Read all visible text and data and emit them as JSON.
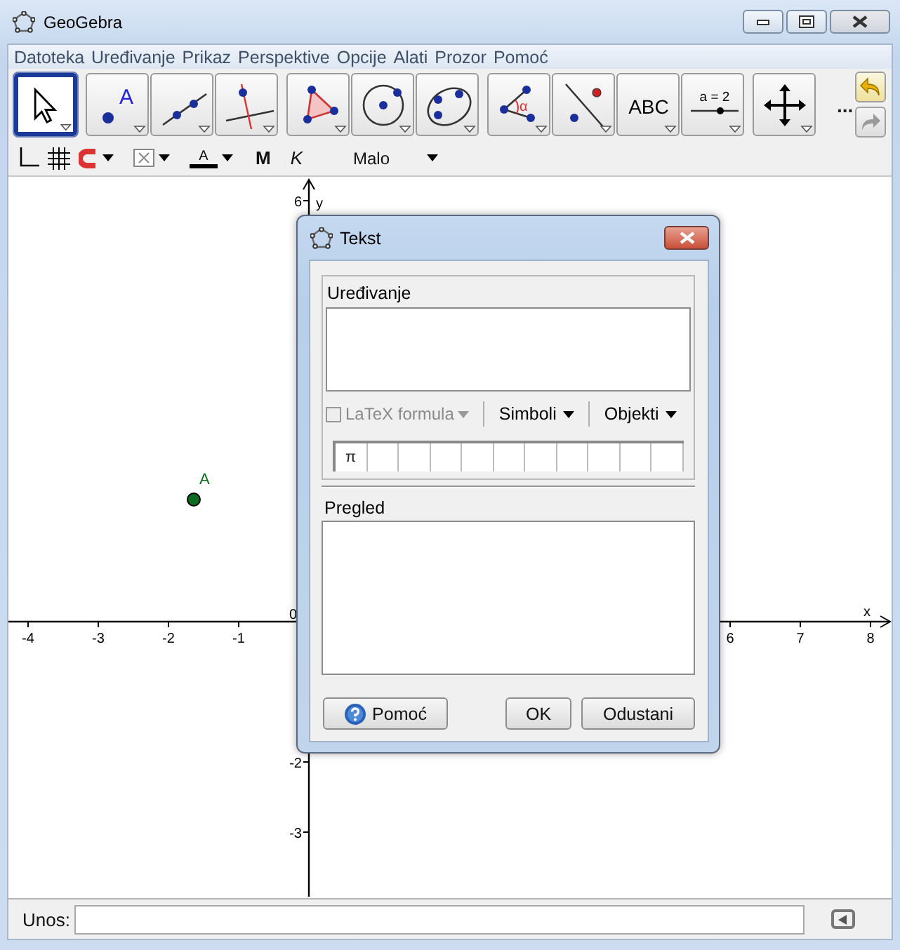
{
  "window": {
    "title": "GeoGebra"
  },
  "menu": [
    "Datoteka",
    "Uređivanje",
    "Prikaz",
    "Perspektive",
    "Opcije",
    "Alati",
    "Prozor",
    "Pomoć"
  ],
  "toolbar": {
    "tools": [
      {
        "kind": "move",
        "selected": true
      },
      {
        "kind": "point",
        "selected": false,
        "text": "A"
      },
      {
        "kind": "line",
        "selected": false
      },
      {
        "kind": "perpendicular",
        "selected": false
      },
      {
        "kind": "polygon",
        "selected": false
      },
      {
        "kind": "circle",
        "selected": false
      },
      {
        "kind": "conic",
        "selected": false
      },
      {
        "kind": "angle",
        "selected": false,
        "text": "α"
      },
      {
        "kind": "reflect",
        "selected": false
      },
      {
        "kind": "text",
        "selected": false,
        "text": "ABC"
      },
      {
        "kind": "slider",
        "selected": false,
        "text": "a = 2"
      },
      {
        "kind": "move_view",
        "selected": false
      }
    ],
    "more": "...",
    "undo": {
      "disabled": false
    },
    "redo": {
      "disabled": true
    }
  },
  "style_bar": {
    "color_letter": "A",
    "bold": "M",
    "italic": "K",
    "size": "Malo"
  },
  "graphics": {
    "x_axis_label": "x",
    "y_axis_label": "y",
    "x_ticks": [
      "-4",
      "-3",
      "-2",
      "-1",
      "0",
      "6",
      "7",
      "8"
    ],
    "y_ticks": [
      "6",
      "-2",
      "-3"
    ],
    "points": [
      {
        "label": "A"
      }
    ]
  },
  "dialog": {
    "title": "Tekst",
    "edit_label": "Uređivanje",
    "latex": {
      "label": "LaTeX formula",
      "checked": false,
      "disabled": true
    },
    "symbols_menu": "Simboli",
    "objects_menu": "Objekti",
    "symbol_cells": [
      "π",
      "",
      "",
      "",
      "",
      "",
      "",
      "",
      "",
      "",
      ""
    ],
    "preview_label": "Pregled",
    "buttons": [
      {
        "kind": "help",
        "label": "Pomoć"
      },
      {
        "kind": "ok",
        "label": "OK"
      },
      {
        "kind": "cancel",
        "label": "Odustani"
      }
    ]
  },
  "input_bar": {
    "label": "Unos:"
  }
}
